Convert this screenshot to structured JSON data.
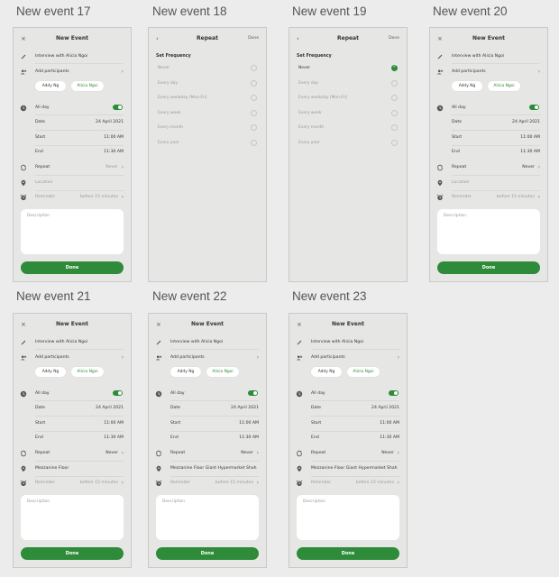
{
  "frames": [
    {
      "title": "New event 17",
      "kind": "form",
      "variant": "a17"
    },
    {
      "title": "New event 18",
      "kind": "repeat",
      "selected": -1
    },
    {
      "title": "New event 19",
      "kind": "repeat",
      "selected": 0
    },
    {
      "title": "New event 20",
      "kind": "form",
      "variant": "a20"
    },
    {
      "title": "New event 21",
      "kind": "form",
      "variant": "a21"
    },
    {
      "title": "New event 22",
      "kind": "form",
      "variant": "a22"
    },
    {
      "title": "New event 23",
      "kind": "form",
      "variant": "a23"
    }
  ],
  "form": {
    "header_title": "New Event",
    "close_glyph": "×",
    "title_value": "Interview with Alicia Ngoi",
    "add_participants": "Add participants",
    "participants": [
      "Addy Ng",
      "Alicia Ngoi"
    ],
    "all_day_label": "All day",
    "date_label": "Date",
    "date_value": "24 April 2021",
    "start_label": "Start",
    "start_value": "11:00 AM",
    "end_label": "End",
    "end_value": "11:30 AM",
    "repeat_label": "Repeat",
    "repeat_value": "Never",
    "location_placeholder": "Location",
    "reminder_label": "Reminder",
    "reminder_value": "before 15 minutes",
    "description_placeholder": "Description",
    "done_label": "Done"
  },
  "variants": {
    "a17": {
      "location": "",
      "repeat_value_muted": true
    },
    "a20": {
      "location": "",
      "repeat_value_muted": false
    },
    "a21": {
      "location": "Mezzanine Floor",
      "repeat_value_muted": false
    },
    "a22": {
      "location": "Mezzanine Floor Giant Hypermarket Shah",
      "repeat_value_muted": false
    },
    "a23": {
      "location": "Mezzanine Floor Giant Hypermarket Shah",
      "repeat_value_muted": false
    }
  },
  "repeat": {
    "header_title": "Repeat",
    "back_glyph": "‹",
    "done_label": "Done",
    "set_frequency": "Set Frequency",
    "options": [
      "Never",
      "Every day",
      "Every weekday (Mon-Fri)",
      "Every week",
      "Every month",
      "Every year"
    ]
  },
  "colors": {
    "accent": "#2e8b3a",
    "screen_bg": "#e6e7e5",
    "page_bg": "#ebeceb"
  },
  "icons": {
    "pencil": "pencil-icon",
    "participants": "add-person-icon",
    "clock": "clock-icon",
    "repeat": "repeat-icon",
    "location": "location-pin-icon",
    "alarm": "alarm-icon"
  }
}
